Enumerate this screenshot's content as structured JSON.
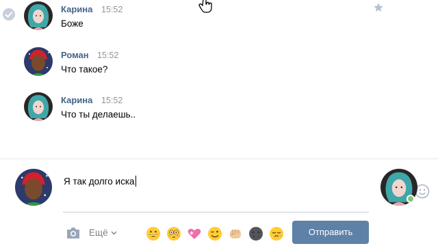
{
  "messages": [
    {
      "author": "Карина",
      "time": "15:52",
      "text": "Боже"
    },
    {
      "author": "Роман",
      "time": "15:52",
      "text": "Что такое?"
    },
    {
      "author": "Карина",
      "time": "15:52",
      "text": "Что ты делаешь.."
    }
  ],
  "composer": {
    "input_value": "Я так долго иска",
    "more_label": "Ещё",
    "send_label": "Отправить",
    "emojis": [
      "grinning-face",
      "flushed-face",
      "sparkling-heart",
      "winking-face",
      "fist",
      "dark-moon-face",
      "sleepy-face"
    ]
  },
  "colors": {
    "author": "#42648b",
    "send_button": "#5e81a8",
    "online": "#8ac176"
  }
}
